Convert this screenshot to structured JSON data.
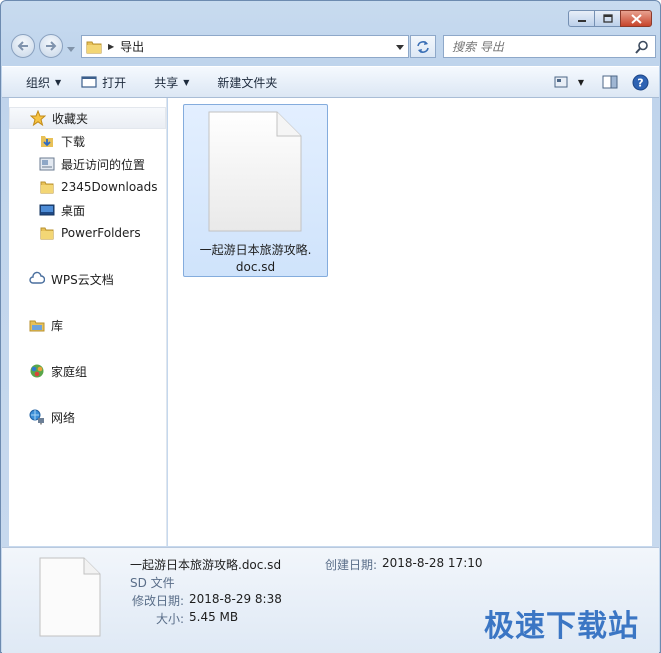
{
  "window": {
    "caption_buttons": [
      "minimize",
      "maximize",
      "close"
    ]
  },
  "address_bar": {
    "path": "导出",
    "dropdown_icon": "chevron-down-icon"
  },
  "search": {
    "placeholder": "搜索 导出"
  },
  "toolbar": {
    "organize_label": "组织",
    "open_label": "打开",
    "share_label": "共享",
    "new_folder_label": "新建文件夹"
  },
  "sidebar": {
    "favorites_label": "收藏夹",
    "favorites": [
      {
        "label": "下载",
        "icon": "download-folder-icon"
      },
      {
        "label": "最近访问的位置",
        "icon": "recent-places-icon"
      },
      {
        "label": "2345Downloads",
        "icon": "folder-icon"
      },
      {
        "label": "桌面",
        "icon": "desktop-icon"
      },
      {
        "label": "PowerFolders",
        "icon": "folder-icon"
      }
    ],
    "wps_label": "WPS云文档",
    "library_label": "库",
    "homegroup_label": "家庭组",
    "network_label": "网络"
  },
  "files": [
    {
      "name_line1": "一起游日本旅游攻略.",
      "name_line2": "doc.sd",
      "selected": true
    }
  ],
  "details": {
    "filename": "一起游日本旅游攻略.doc.sd",
    "type": "SD 文件",
    "modified_label": "修改日期:",
    "modified_value": "2018-8-29 8:38",
    "size_label": "大小:",
    "size_value": "5.45 MB",
    "created_label": "创建日期:",
    "created_value": "2018-8-28 17:10"
  },
  "watermark": "极速下载站",
  "colors": {
    "selection": "#cfe3fb",
    "selection_border": "#84acdd",
    "close_button": "#c7442b",
    "watermark": "#3b76c4"
  }
}
